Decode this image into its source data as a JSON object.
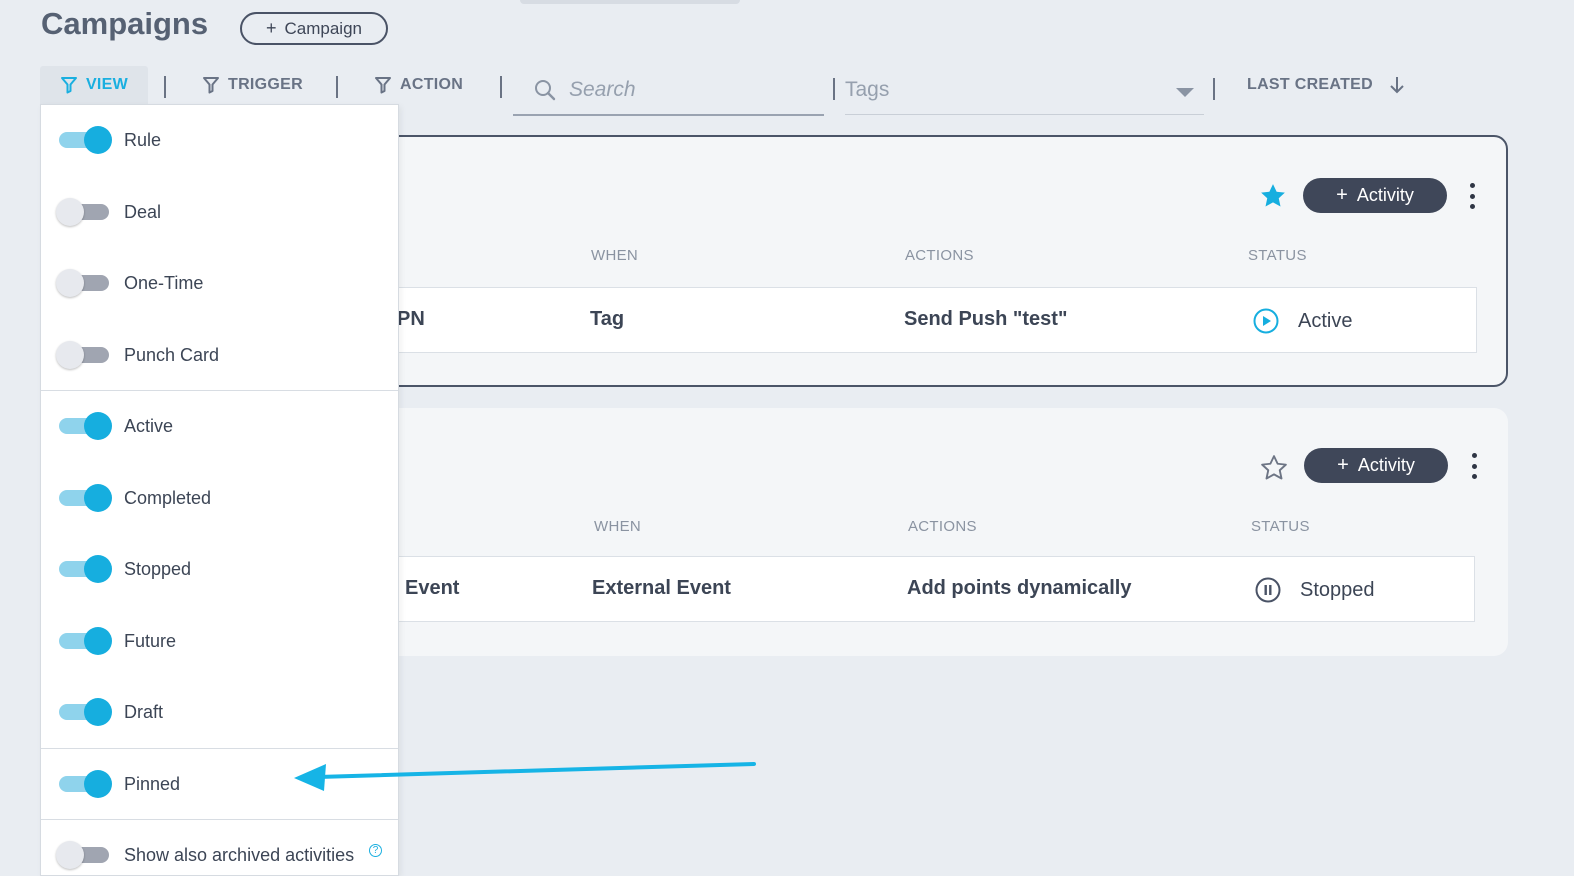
{
  "header": {
    "title": "Campaigns",
    "add_campaign_label": "Campaign"
  },
  "toolbar": {
    "view_label": "VIEW",
    "trigger_label": "TRIGGER",
    "action_label": "ACTION",
    "search_placeholder": "Search",
    "tags_placeholder": "Tags",
    "sort_label": "LAST CREATED"
  },
  "view_menu": {
    "items": [
      {
        "label": "Rule",
        "on": true
      },
      {
        "label": "Deal",
        "on": false
      },
      {
        "label": "One-Time",
        "on": false
      },
      {
        "label": "Punch Card",
        "on": false
      },
      {
        "label": "Active",
        "on": true
      },
      {
        "label": "Completed",
        "on": true
      },
      {
        "label": "Stopped",
        "on": true
      },
      {
        "label": "Future",
        "on": true
      },
      {
        "label": "Draft",
        "on": true
      },
      {
        "label": "Pinned",
        "on": true
      },
      {
        "label": "Show also archived activities",
        "on": false
      }
    ]
  },
  "campaigns": [
    {
      "pinned": true,
      "add_activity_label": "Activity",
      "columns": {
        "when": "WHEN",
        "actions": "ACTIONS",
        "status": "STATUS"
      },
      "row": {
        "name_fragment": "PN",
        "when": "Tag",
        "actions": "Send Push \"test\"",
        "status": "Active"
      }
    },
    {
      "pinned": false,
      "add_activity_label": "Activity",
      "columns": {
        "when": "WHEN",
        "actions": "ACTIONS",
        "status": "STATUS"
      },
      "row": {
        "name_fragment": "Event",
        "when": "External Event",
        "actions": "Add points dynamically",
        "status": "Stopped"
      }
    }
  ],
  "colors": {
    "accent": "#16aedf",
    "dark_button": "#3f4759",
    "background": "#e9edf2"
  }
}
